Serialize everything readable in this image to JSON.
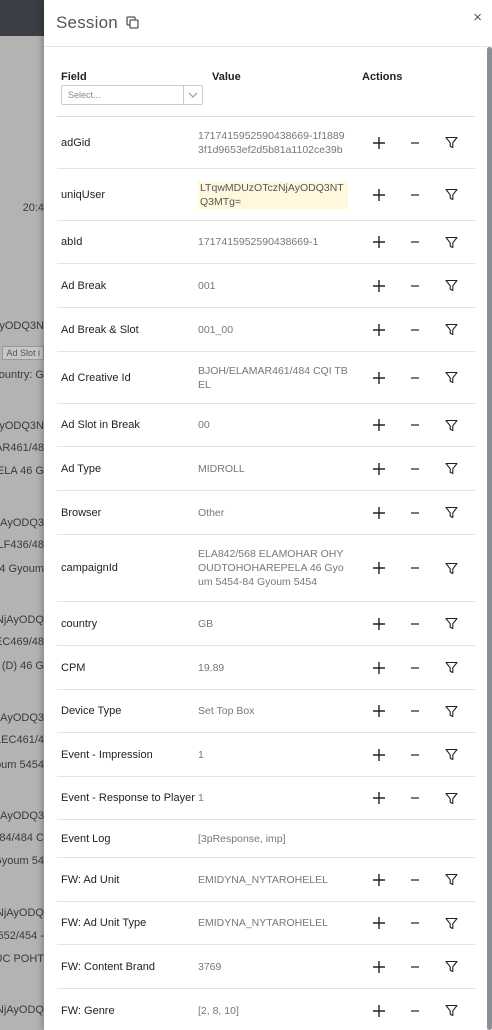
{
  "background": {
    "texts": [
      {
        "text": "20:4"
      },
      {
        "text": "AyODQ3N"
      },
      {
        "text": "Ad Slot i",
        "chip": true
      },
      {
        "text": "ountry:  G"
      },
      {
        "text": "AyODQ3N"
      },
      {
        "text": "AR461/48"
      },
      {
        "text": "PELA 46 G"
      },
      {
        "text": "NjAyODQ3"
      },
      {
        "text": "ELF436/48"
      },
      {
        "text": "-84 Gyoum"
      },
      {
        "text": "NjAyODQ"
      },
      {
        "text": "EC469/48"
      },
      {
        "text": "(D) 46 G"
      },
      {
        "text": "NjAyODQ3"
      },
      {
        "text": "LEC461/4"
      },
      {
        "text": "youm 5454"
      },
      {
        "text": "NjAyODQ3"
      },
      {
        "text": "584/484 C"
      },
      {
        "text": "Gyoum 54"
      },
      {
        "text": "NjAyODQ"
      },
      {
        "text": "552/454 -"
      },
      {
        "text": "UC POHT"
      },
      {
        "text": "NjAyODQ"
      }
    ]
  },
  "drawer": {
    "title": "Session",
    "close": "×"
  },
  "table": {
    "headers": {
      "field": "Field",
      "value": "Value",
      "actions": "Actions"
    },
    "select_placeholder": "Select...",
    "rows": [
      {
        "field": "adGid",
        "value": "1717415952590438669-1f18893f1d9653ef2d5b81a1102ce39b",
        "h": 52,
        "actions": true
      },
      {
        "field": "uniqUser",
        "value": "LTqwMDUzOTczNjAyODQ3NTQ3MTg=",
        "h": 52,
        "actions": true,
        "highlight": true
      },
      {
        "field": "abId",
        "value": "1717415952590438669-1",
        "h": 43,
        "actions": true
      },
      {
        "field": "Ad Break",
        "value": "001",
        "h": 44,
        "actions": true
      },
      {
        "field": "Ad Break & Slot",
        "value": "001_00",
        "h": 44,
        "actions": true
      },
      {
        "field": "Ad Creative Id",
        "value": "BJOH/ELAMAR461/484 CQI TBEL",
        "h": 52,
        "actions": true
      },
      {
        "field": "Ad Slot in Break",
        "value": "00",
        "h": 43,
        "actions": true
      },
      {
        "field": "Ad Type",
        "value": "MIDROLL",
        "h": 44,
        "actions": true
      },
      {
        "field": "Browser",
        "value": "Other",
        "h": 44,
        "actions": true
      },
      {
        "field": "campaignId",
        "value": "ELA842/568 ELAMOHAR OHY OUDTOHOHAREPELA 46 Gyoum 5454-84 Gyoum 5454",
        "h": 67,
        "actions": true
      },
      {
        "field": "country",
        "value": "GB",
        "h": 44,
        "actions": true
      },
      {
        "field": "CPM",
        "value": "19.89",
        "h": 44,
        "actions": true
      },
      {
        "field": "Device Type",
        "value": "Set Top Box",
        "h": 43,
        "actions": true
      },
      {
        "field": "Event - Impression",
        "value": "1",
        "h": 44,
        "actions": true
      },
      {
        "field": "Event - Response to Player",
        "value": "1",
        "h": 43,
        "actions": true
      },
      {
        "field": "Event Log",
        "value": "[3pResponse, imp]",
        "h": 38,
        "actions": false
      },
      {
        "field": "FW: Ad Unit",
        "value": "EMIDYNA_NYTAROHELEL",
        "h": 44,
        "actions": true
      },
      {
        "field": "FW: Ad Unit Type",
        "value": "EMIDYNA_NYTAROHELEL",
        "h": 43,
        "actions": true
      },
      {
        "field": "FW: Content Brand",
        "value": "3769",
        "h": 44,
        "actions": true
      },
      {
        "field": "FW: Genre",
        "value": "[2, 8, 10]",
        "h": 44,
        "actions": true
      }
    ]
  },
  "icons": {
    "copy": "copy-icon",
    "plus": "plus-icon",
    "minus": "minus-icon",
    "filter": "filter-icon",
    "caret": "chevron-down-icon"
  }
}
